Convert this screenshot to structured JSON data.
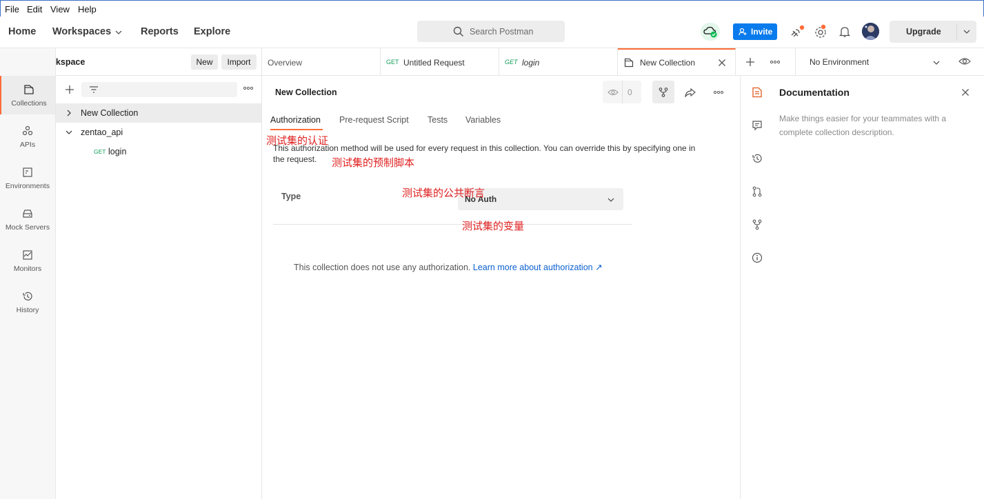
{
  "menu": [
    "File",
    "Edit",
    "View",
    "Help"
  ],
  "header": {
    "nav": [
      "Home",
      "Workspaces",
      "Reports",
      "Explore"
    ],
    "search_placeholder": "Search Postman",
    "invite_label": "Invite",
    "upgrade_label": "Upgrade"
  },
  "workspace": {
    "name": "My Workspace",
    "new_label": "New",
    "import_label": "Import"
  },
  "rail": [
    {
      "label": "Collections",
      "icon": "collections-icon"
    },
    {
      "label": "APIs",
      "icon": "apis-icon"
    },
    {
      "label": "Environments",
      "icon": "environments-icon"
    },
    {
      "label": "Mock Servers",
      "icon": "mock-servers-icon"
    },
    {
      "label": "Monitors",
      "icon": "monitors-icon"
    },
    {
      "label": "History",
      "icon": "history-icon"
    }
  ],
  "tree": {
    "collection1": "New Collection",
    "collection2": "zentao_api",
    "request_method": "GET",
    "request_name": "login"
  },
  "tabs": {
    "overview": "Overview",
    "tab2_method": "GET",
    "tab2_label": "Untitled Request",
    "tab3_method": "GET",
    "tab3_label": "login",
    "tab4_label": "New Collection",
    "environment": "No Environment"
  },
  "collection": {
    "title": "New Collection",
    "watch_count": "0",
    "subtabs": [
      "Authorization",
      "Pre-request Script",
      "Tests",
      "Variables"
    ],
    "auth_description": "This authorization method will be used for every request in this collection. You can override this by specifying one in the request.",
    "auth_description_line1": "This authorization method will be used for every request in this collection. You can override this by specifying one in",
    "auth_description_line2": "the request.",
    "type_label": "Type",
    "type_value": "No Auth",
    "no_auth_message": "This collection does not use any authorization.",
    "learn_more": "Learn more about authorization ↗"
  },
  "annotations": {
    "auth": "测试集的认证",
    "prerequest": "测试集的预制脚本",
    "tests": "测试集的公共断言",
    "variables": "测试集的变量"
  },
  "documentation": {
    "title": "Documentation",
    "line1": "Make things easier for your teammates with a",
    "line2": "complete collection description."
  },
  "colors": {
    "accent": "#ff6c37",
    "invite_blue": "#097bed",
    "get_green": "#0f9d58",
    "annotation_red": "#e02020",
    "link_blue": "#0b5fd0"
  }
}
